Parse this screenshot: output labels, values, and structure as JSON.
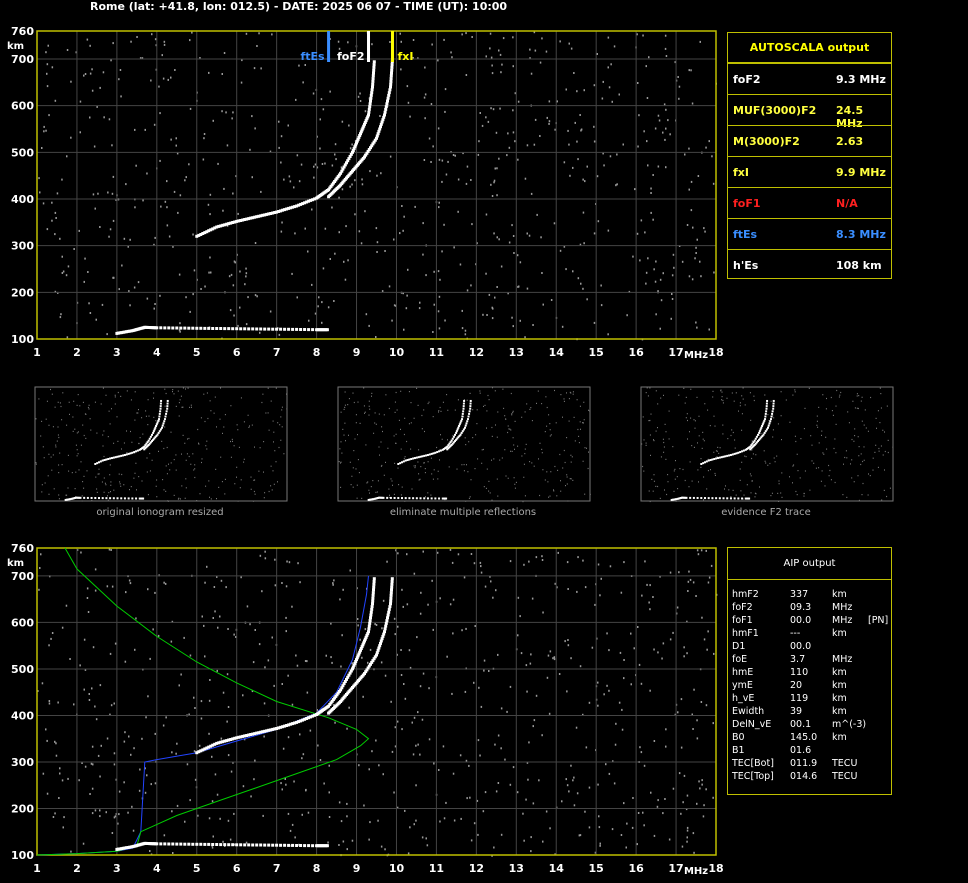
{
  "header": "Rome (lat: +41.8, lon: 012.5) - DATE: 2025 06 07 - TIME (UT): 10:00",
  "colors": {
    "frame": "#bfbf00",
    "yellow": "#ffff00",
    "red": "#ff2020",
    "blue": "#3a8eff",
    "green": "#00cc00",
    "trace": "#ffffff"
  },
  "autoscala": {
    "title": "AUTOSCALA output",
    "rows": [
      {
        "label": "foF2",
        "value": "9.3 MHz",
        "color": "#ffffff"
      },
      {
        "label": "MUF(3000)F2",
        "value": "24.5 MHz",
        "color": "#ffff40"
      },
      {
        "label": "M(3000)F2",
        "value": "2.63",
        "color": "#ffff40"
      },
      {
        "label": "fxI",
        "value": "9.9 MHz",
        "color": "#ffff40"
      },
      {
        "label": "foF1",
        "value": "N/A",
        "color": "#ff2020"
      },
      {
        "label": "ftEs",
        "value": "8.3 MHz",
        "color": "#3a8eff"
      },
      {
        "label": "h'Es",
        "value": "108    km",
        "color": "#ffffff"
      }
    ]
  },
  "aip": {
    "title": "AIP output",
    "rows": [
      {
        "name": "hmF2",
        "value": "337",
        "unit": "km",
        "extra": ""
      },
      {
        "name": "foF2",
        "value": "09.3",
        "unit": "MHz",
        "extra": ""
      },
      {
        "name": "foF1",
        "value": "00.0",
        "unit": "MHz",
        "extra": "[PN]"
      },
      {
        "name": "hmF1",
        "value": "---",
        "unit": "km",
        "extra": ""
      },
      {
        "name": "D1",
        "value": "00.0",
        "unit": "",
        "extra": ""
      },
      {
        "name": "foE",
        "value": "3.7",
        "unit": "MHz",
        "extra": ""
      },
      {
        "name": "hmE",
        "value": "110",
        "unit": "km",
        "extra": ""
      },
      {
        "name": "ymE",
        "value": "20",
        "unit": "km",
        "extra": ""
      },
      {
        "name": "h_vE",
        "value": "119",
        "unit": "km",
        "extra": ""
      },
      {
        "name": "Ewidth",
        "value": "39",
        "unit": "km",
        "extra": ""
      },
      {
        "name": "DelN_vE",
        "value": "00.1",
        "unit": "m^(-3)",
        "extra": ""
      },
      {
        "name": "B0",
        "value": "145.0",
        "unit": "km",
        "extra": ""
      },
      {
        "name": "B1",
        "value": "01.6",
        "unit": "",
        "extra": ""
      },
      {
        "name": "TEC[Bot]",
        "value": "011.9",
        "unit": "TECU",
        "extra": ""
      },
      {
        "name": "TEC[Top]",
        "value": "014.6",
        "unit": "TECU",
        "extra": ""
      }
    ]
  },
  "thumbnails": [
    {
      "caption": "original ionogram resized"
    },
    {
      "caption": "eliminate multiple reflections"
    },
    {
      "caption": "evidence F2 trace"
    }
  ],
  "markers": [
    {
      "label": "ftEs",
      "freq": 8.3,
      "color": "#3a8eff"
    },
    {
      "label": "foF2",
      "freq": 9.3,
      "color": "#ffffff"
    },
    {
      "label": "fxI",
      "freq": 9.9,
      "color": "#ffff00"
    }
  ],
  "chart_data": [
    {
      "type": "scatter",
      "title": "",
      "xlabel": "MHz",
      "ylabel": "km",
      "xlim": [
        1,
        18
      ],
      "ylim": [
        100,
        760
      ],
      "xticks": [
        1,
        2,
        3,
        4,
        5,
        6,
        7,
        8,
        9,
        10,
        11,
        12,
        13,
        14,
        15,
        16,
        17,
        18
      ],
      "yticks": [
        100,
        200,
        300,
        400,
        500,
        600,
        700,
        760
      ],
      "grid": true,
      "series": [
        {
          "values": [
            [
              5.0,
              320
            ],
            [
              5.5,
              340
            ],
            [
              6.0,
              352
            ],
            [
              6.5,
              362
            ],
            [
              7.0,
              372
            ],
            [
              7.5,
              385
            ],
            [
              8.0,
              402
            ],
            [
              8.3,
              420
            ],
            [
              8.6,
              455
            ],
            [
              8.9,
              500
            ],
            [
              9.1,
              540
            ],
            [
              9.3,
              580
            ],
            [
              9.4,
              640
            ],
            [
              9.45,
              700
            ]
          ]
        },
        {
          "values": [
            [
              8.3,
              405
            ],
            [
              8.6,
              430
            ],
            [
              8.9,
              460
            ],
            [
              9.2,
              490
            ],
            [
              9.5,
              530
            ],
            [
              9.7,
              580
            ],
            [
              9.85,
              640
            ],
            [
              9.9,
              700
            ]
          ]
        },
        {
          "values": [
            [
              3.0,
              112
            ],
            [
              3.4,
              118
            ],
            [
              3.7,
              125
            ],
            [
              4.0,
              124
            ],
            [
              5.0,
              123
            ],
            [
              6.0,
              122
            ],
            [
              7.0,
              121
            ],
            [
              8.0,
              120
            ],
            [
              8.3,
              120
            ]
          ]
        }
      ]
    },
    {
      "type": "line",
      "title": "",
      "xlabel": "MHz",
      "ylabel": "km",
      "xlim": [
        1,
        18
      ],
      "ylim": [
        100,
        760
      ],
      "xticks": [
        1,
        2,
        3,
        4,
        5,
        6,
        7,
        8,
        9,
        10,
        11,
        12,
        13,
        14,
        15,
        16,
        17,
        18
      ],
      "yticks": [
        100,
        200,
        300,
        400,
        500,
        600,
        700,
        760
      ],
      "grid": true,
      "series": [
        {
          "values": [
            [
              1.0,
              100
            ],
            [
              2.0,
              103
            ],
            [
              3.0,
              108
            ],
            [
              3.4,
              115
            ],
            [
              3.6,
              150
            ],
            [
              3.7,
              300
            ],
            [
              4.0,
              305
            ],
            [
              5.0,
              320
            ],
            [
              6.0,
              345
            ],
            [
              7.0,
              370
            ],
            [
              8.0,
              405
            ],
            [
              8.5,
              450
            ],
            [
              8.9,
              520
            ],
            [
              9.1,
              590
            ],
            [
              9.25,
              660
            ],
            [
              9.3,
              700
            ]
          ]
        },
        {
          "values": [
            [
              1.0,
              100
            ],
            [
              2.0,
              103
            ],
            [
              3.0,
              108
            ],
            [
              3.5,
              120
            ],
            [
              3.6,
              150
            ],
            [
              4.5,
              185
            ],
            [
              5.5,
              215
            ],
            [
              6.5,
              245
            ],
            [
              7.5,
              275
            ],
            [
              8.5,
              305
            ],
            [
              9.1,
              335
            ],
            [
              9.3,
              350
            ],
            [
              9.0,
              370
            ],
            [
              8.3,
              395
            ],
            [
              7.0,
              430
            ],
            [
              6.0,
              470
            ],
            [
              5.0,
              515
            ],
            [
              4.0,
              570
            ],
            [
              3.0,
              635
            ],
            [
              2.0,
              715
            ],
            [
              1.7,
              760
            ]
          ]
        },
        {
          "values": [
            [
              5.0,
              320
            ],
            [
              5.5,
              340
            ],
            [
              6.0,
              352
            ],
            [
              6.5,
              362
            ],
            [
              7.0,
              372
            ],
            [
              7.5,
              385
            ],
            [
              8.0,
              402
            ],
            [
              8.3,
              420
            ],
            [
              8.6,
              455
            ],
            [
              8.9,
              500
            ],
            [
              9.1,
              540
            ],
            [
              9.3,
              580
            ],
            [
              9.4,
              640
            ],
            [
              9.45,
              700
            ]
          ]
        },
        {
          "values": [
            [
              8.3,
              405
            ],
            [
              8.6,
              430
            ],
            [
              8.9,
              460
            ],
            [
              9.2,
              490
            ],
            [
              9.5,
              530
            ],
            [
              9.7,
              580
            ],
            [
              9.85,
              640
            ],
            [
              9.9,
              700
            ]
          ]
        },
        {
          "values": [
            [
              3.0,
              112
            ],
            [
              3.4,
              118
            ],
            [
              3.7,
              125
            ],
            [
              4.0,
              124
            ],
            [
              5.0,
              123
            ],
            [
              6.0,
              122
            ],
            [
              7.0,
              121
            ],
            [
              8.0,
              120
            ],
            [
              8.3,
              120
            ]
          ]
        }
      ]
    }
  ]
}
